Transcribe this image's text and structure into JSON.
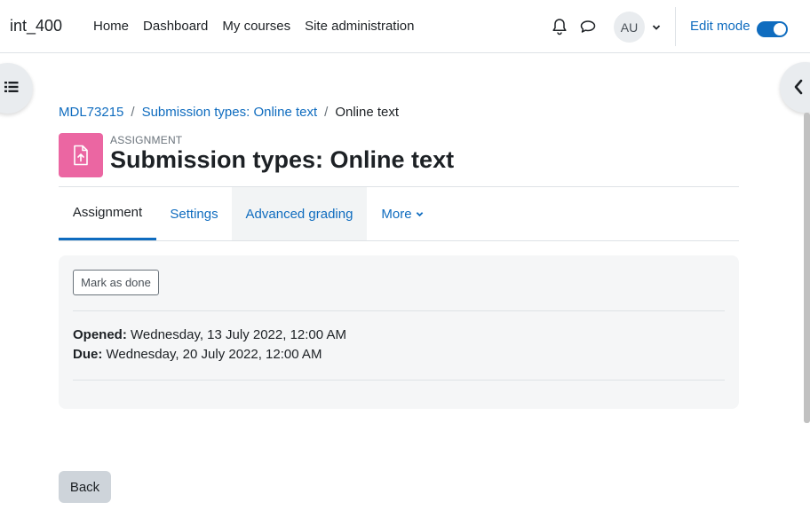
{
  "navbar": {
    "brand": "int_400",
    "links": [
      "Home",
      "Dashboard",
      "My courses",
      "Site administration"
    ],
    "avatar_initials": "AU",
    "edit_mode_label": "Edit mode",
    "edit_mode_on": true
  },
  "breadcrumb": {
    "items": [
      "MDL73215",
      "Submission types: Online text"
    ],
    "current": "Online text"
  },
  "header": {
    "activity_type": "ASSIGNMENT",
    "title": "Submission types: Online text",
    "icon": "assignment-file-upload-icon"
  },
  "tabs": [
    "Assignment",
    "Settings",
    "Advanced grading",
    "More"
  ],
  "activity": {
    "mark_done_label": "Mark as done",
    "opened_label": "Opened:",
    "opened_value": "Wednesday, 13 July 2022, 12:00 AM",
    "due_label": "Due:",
    "due_value": "Wednesday, 20 July 2022, 12:00 AM"
  },
  "back_label": "Back",
  "colors": {
    "link": "#0f6cbf",
    "activity_icon_bg": "#eb66a2",
    "card_bg": "#f5f6f7"
  }
}
